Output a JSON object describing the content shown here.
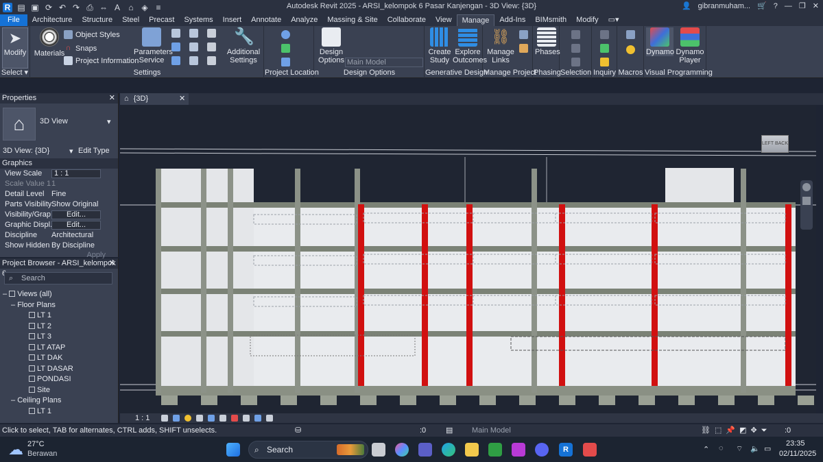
{
  "window": {
    "title": "Autodesk Revit 2025 - ARSI_kelompok 6 Pasar Kanjengan - 3D View: {3D}",
    "user": "gibranmuham...",
    "controls": {
      "minimize": "—",
      "restore": "❐",
      "close": "✕"
    }
  },
  "ribbon_tabs": [
    "File",
    "Architecture",
    "Structure",
    "Steel",
    "Precast",
    "Systems",
    "Insert",
    "Annotate",
    "Analyze",
    "Massing & Site",
    "Collaborate",
    "View",
    "Manage",
    "Add-Ins",
    "BIMsmith",
    "Modify"
  ],
  "active_tab": "Manage",
  "ribbon": {
    "select": {
      "modify": "Modify",
      "group": "Select ▾"
    },
    "settings": {
      "materials": "Materials",
      "object_styles": "Object Styles",
      "snaps": "Snaps",
      "project_information": "Project Information",
      "parameters_service_1": "Parameters",
      "parameters_service_2": "Service",
      "additional_settings_1": "Additional",
      "additional_settings_2": "Settings",
      "group": "Settings"
    },
    "project_location": {
      "group": "Project Location"
    },
    "design_options": {
      "btn_1": "Design",
      "btn_2": "Options",
      "main_model": "Main Model",
      "group": "Design Options"
    },
    "generative_design": {
      "create_1": "Create",
      "create_2": "Study",
      "explore_1": "Explore",
      "explore_2": "Outcomes",
      "group": "Generative Design"
    },
    "manage_project": {
      "links_1": "Manage",
      "links_2": "Links",
      "group": "Manage Project"
    },
    "phasing": {
      "phases": "Phases",
      "group": "Phasing"
    },
    "selection": {
      "group": "Selection"
    },
    "inquiry": {
      "group": "Inquiry"
    },
    "macros": {
      "group": "Macros"
    },
    "visual_programming": {
      "dynamo": "Dynamo",
      "player_1": "Dynamo",
      "player_2": "Player",
      "group": "Visual Programming"
    }
  },
  "properties": {
    "title": "Properties",
    "type_name": "3D View",
    "instance": "3D View: {3D}",
    "edit_type": "Edit Type",
    "section": "Graphics",
    "rows": [
      {
        "k": "View Scale",
        "v": "1 : 1"
      },
      {
        "k": "Scale Value   1:",
        "v": "1"
      },
      {
        "k": "Detail Level",
        "v": "Fine"
      },
      {
        "k": "Parts Visibility",
        "v": "Show Original"
      },
      {
        "k": "Visibility/Grap...",
        "v": "Edit..."
      },
      {
        "k": "Graphic Displ...",
        "v": "Edit..."
      },
      {
        "k": "Discipline",
        "v": "Architectural"
      },
      {
        "k": "Show Hidden ...",
        "v": "By Discipline"
      }
    ],
    "apply": "Apply"
  },
  "project_browser": {
    "title": "Project Browser - ARSI_kelompok 6...",
    "search_placeholder": "Search",
    "views_root": "Views (all)",
    "floor_plans": "Floor Plans",
    "floor_items": [
      "LT 1",
      "LT 2",
      "LT 3",
      "LT ATAP",
      "LT DAK",
      "LT DASAR",
      "PONDASI",
      "Site"
    ],
    "ceiling_plans": "Ceiling Plans",
    "ceiling_items": [
      "LT 1"
    ]
  },
  "view_tab": {
    "label": "{3D}",
    "close": "✕"
  },
  "viewcube": {
    "left": "LEFT",
    "back": "BACK"
  },
  "view_control_bar": {
    "scale": "1 : 1"
  },
  "status": {
    "hint": "Click to select, TAB for alternates, CTRL adds, SHIFT unselects.",
    "worksets": ":0",
    "design_option": "Main Model",
    "filter_count": ":0"
  },
  "taskbar": {
    "weather_temp": "27°C",
    "weather_desc": "Berawan",
    "search": "Search",
    "time": "23:35",
    "date": "02/11/2025"
  },
  "colors": {
    "accent": "#1572d6",
    "chrome": "#3a4152",
    "dark": "#2b3140",
    "canvas": "#1f2532",
    "column_red": "#d11010"
  }
}
